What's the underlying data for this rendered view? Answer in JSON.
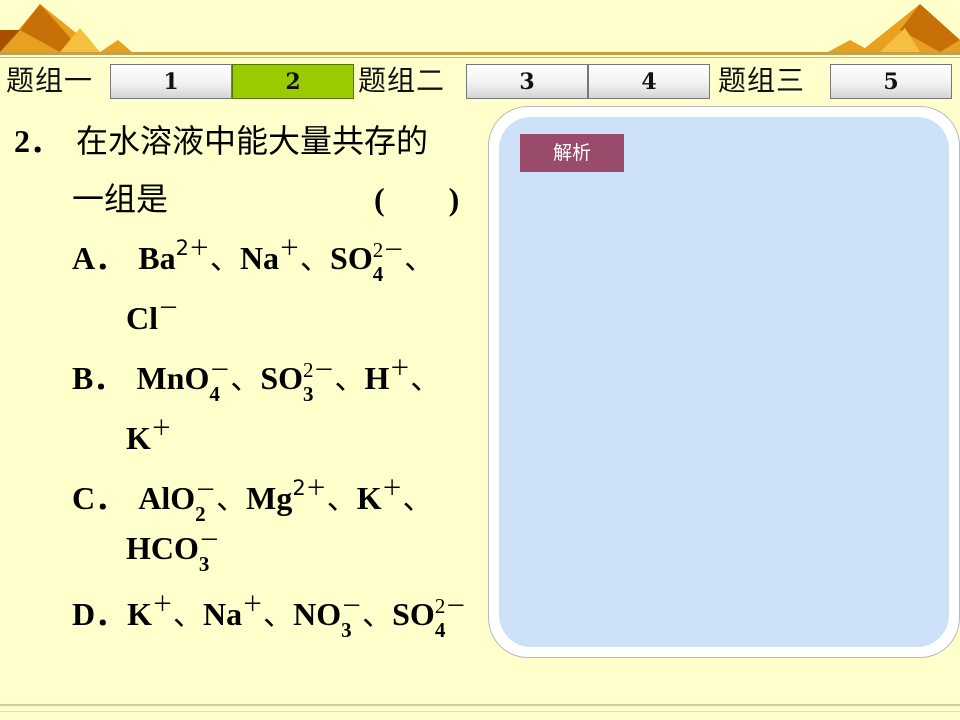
{
  "nav": {
    "groups": [
      {
        "label": "题组一"
      },
      {
        "label": "题组二"
      },
      {
        "label": "题组三"
      }
    ],
    "tabs": [
      "1",
      "2",
      "3",
      "4",
      "5"
    ],
    "active_tab": "2"
  },
  "question": {
    "number": "2．",
    "stem_line1": "在水溶液中能大量共存的",
    "stem_line2": "一组是",
    "paren": "(　　)",
    "options": {
      "A": {
        "letter": "A．",
        "ions": [
          "Ba",
          "2＋",
          "Na",
          "＋",
          "SO",
          "2－",
          "4",
          "Cl",
          "－"
        ]
      },
      "B": {
        "letter": "B．",
        "ions": [
          "MnO",
          "－",
          "4",
          "SO",
          "2－",
          "3",
          "H",
          "＋",
          "K",
          "＋"
        ]
      },
      "C": {
        "letter": "C．",
        "ions": [
          "AlO",
          "－",
          "2",
          "Mg",
          "2＋",
          "K",
          "＋",
          "HCO",
          "－",
          "3"
        ]
      },
      "D": {
        "letter": "D．",
        "ions": [
          "K",
          "＋",
          "Na",
          "＋",
          "NO",
          "－",
          "3",
          "SO",
          "2－",
          "4"
        ]
      }
    },
    "separator": "、"
  },
  "analysis": {
    "button_label": "解析"
  }
}
